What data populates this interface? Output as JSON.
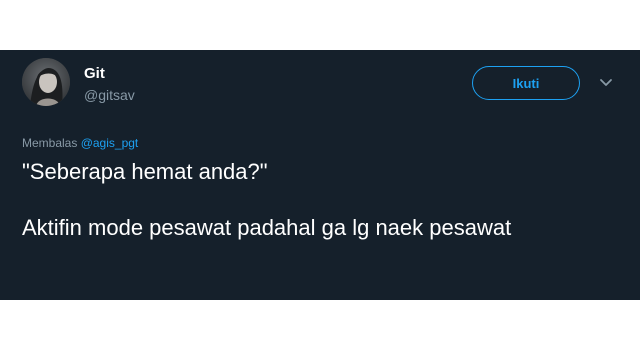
{
  "user": {
    "display_name": "Git",
    "handle": "@gitsav"
  },
  "actions": {
    "follow_label": "Ikuti"
  },
  "reply": {
    "prefix": "Membalas",
    "mention": "@agis_pgt"
  },
  "tweet": {
    "paragraphs": [
      "\"Seberapa hemat anda?\"",
      "Aktifin mode pesawat padahal ga lg naek pesawat"
    ]
  },
  "theme": {
    "background": "#15202b",
    "accent": "#1da1f2",
    "muted": "#8899a6"
  },
  "icons": {
    "menu": "chevron-down-icon",
    "avatar": "avatar"
  }
}
